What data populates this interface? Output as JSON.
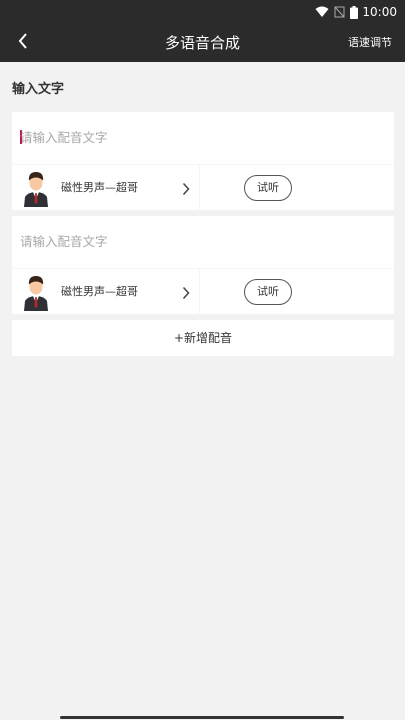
{
  "status_bar": {
    "time": "10:00",
    "icons": [
      "wifi-icon",
      "signal-off-icon",
      "battery-icon"
    ],
    "background": "#2b2b2b"
  },
  "app_bar": {
    "title": "多语音合成",
    "back_icon": "chevron-left-icon",
    "speed_label": "语速调节",
    "background": "#2b2b2b"
  },
  "section": {
    "label": "输入文字"
  },
  "cards": [
    {
      "text_value": "",
      "placeholder": "请输入配音文字",
      "voice_name": "磁性男声—超哥",
      "listen_label": "试听",
      "avatar_icon": "male-avatar-icon"
    },
    {
      "text_value": "",
      "placeholder": "请输入配音文字",
      "voice_name": "磁性男声—超哥",
      "listen_label": "试听",
      "avatar_icon": "male-avatar-icon"
    }
  ],
  "add_voice_label": "+新增配音",
  "colors": {
    "page_background": "#f2f2f2",
    "card_background": "#ffffff",
    "caret": "#c2185b"
  }
}
